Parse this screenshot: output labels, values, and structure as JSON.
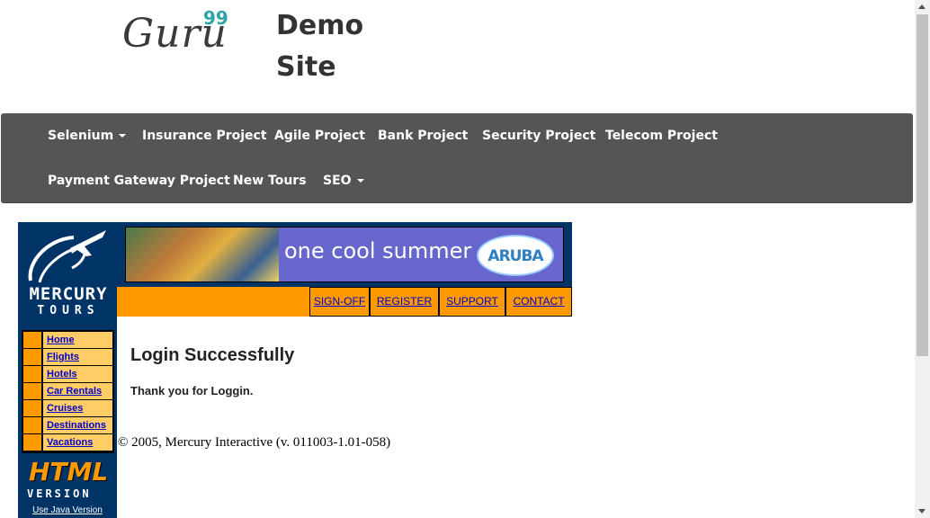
{
  "header": {
    "logo_word": "Guru",
    "logo_sup": "99",
    "title": "Demo Site"
  },
  "navbar": {
    "items": [
      {
        "label": "Selenium",
        "dropdown": true
      },
      {
        "label": "Insurance Project",
        "dropdown": false
      },
      {
        "label": "Agile Project",
        "dropdown": false
      },
      {
        "label": "Bank Project",
        "dropdown": false
      },
      {
        "label": "Security Project",
        "dropdown": false
      },
      {
        "label": "Telecom Project",
        "dropdown": false
      },
      {
        "label": "Payment Gateway Project",
        "dropdown": false
      },
      {
        "label": "New Tours",
        "dropdown": false
      },
      {
        "label": "SEO",
        "dropdown": true
      }
    ]
  },
  "mercury": {
    "logo_line1": "MERCURY",
    "logo_line2": "TOURS",
    "banner_text": "one cool summer",
    "banner_badge": "ARUBA",
    "top_links": [
      "SIGN-OFF",
      "REGISTER",
      "SUPPORT",
      "CONTACT"
    ],
    "side_links": [
      "Home",
      "Flights",
      "Hotels",
      "Car Rentals",
      "Cruises",
      "Destinations",
      "Vacations"
    ],
    "html_version_line1": "HTML",
    "html_version_line2": "VERSION",
    "java_link": "Use Java Version"
  },
  "content": {
    "title": "Login Successfully",
    "message": "Thank you for Loggin.",
    "copyright": "© 2005, Mercury Interactive (v. 011003-1.01-058)"
  },
  "colors": {
    "navbar_bg": "#555555",
    "mercury_navy": "#003366",
    "mercury_orange": "#ff9900",
    "side_link_bg": "#ffcc66",
    "logo_accent": "#2fa4a4"
  },
  "icons": [
    "airplane-logo-icon",
    "caret-down-icon",
    "scroll-up-icon",
    "scroll-down-icon"
  ]
}
